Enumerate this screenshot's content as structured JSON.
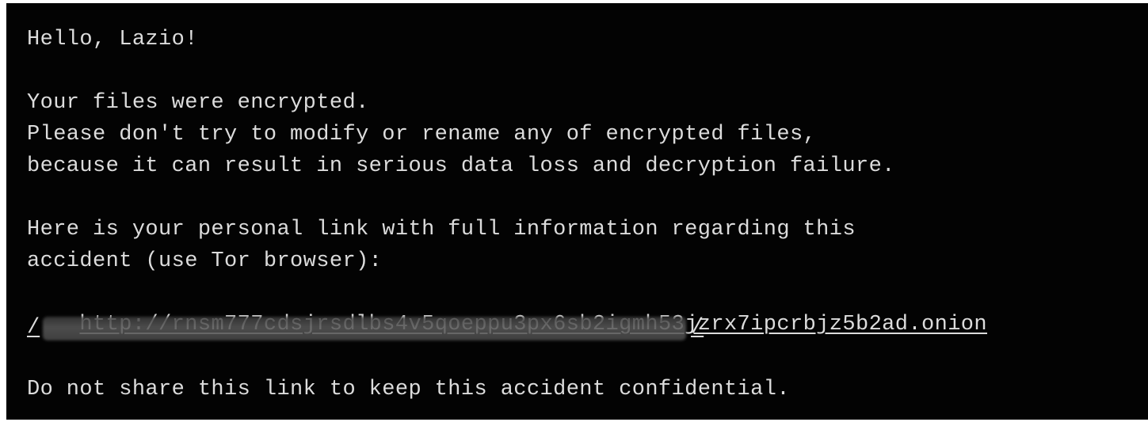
{
  "note": {
    "greeting": "Hello, Lazio!",
    "line_encrypted": "Your files were encrypted.",
    "line_warning_1": "Please don't try to modify or rename any of encrypted files,",
    "line_warning_2": "because it can result in serious data loss and decryption failure.",
    "line_link_intro_1": "Here is your personal link with full information regarding this",
    "line_link_intro_2": "accident (use Tor browser):",
    "onion_link": "http://rnsm777cdsjrsdlbs4v5qoeppu3px6sb2igmh53jzrx7ipcrbjz5b2ad.onion",
    "link_path_start": "/",
    "link_path_end": "/",
    "closing": "Do not share this link to keep this accident confidential."
  },
  "colors": {
    "background": "#030303",
    "text": "#dcdcdc"
  }
}
